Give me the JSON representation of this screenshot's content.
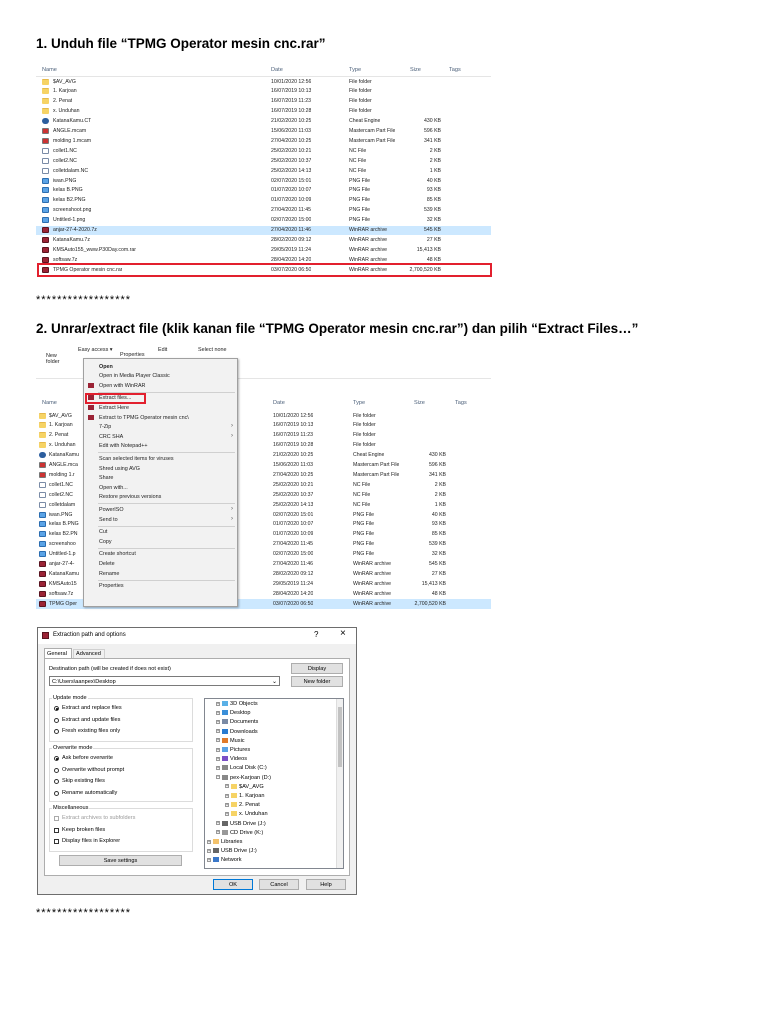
{
  "step1": {
    "title": "1.  Unduh file “TPMG Operator mesin cnc.rar”",
    "explorer": {
      "headers": {
        "name": "Name",
        "date": "Date",
        "type": "Type",
        "size": "Size",
        "tags": "Tags"
      },
      "rows": [
        {
          "name": "$AV_AVG",
          "date": "10/01/2020 12:56",
          "type": "File folder",
          "size": "",
          "icon": "folder"
        },
        {
          "name": "1. Karjoan",
          "date": "16/07/2019 10:13",
          "type": "File folder",
          "size": "",
          "icon": "folder"
        },
        {
          "name": "2. Penat",
          "date": "16/07/2019 11:23",
          "type": "File folder",
          "size": "",
          "icon": "folder"
        },
        {
          "name": "x. Unduhan",
          "date": "16/07/2019 10:28",
          "type": "File folder",
          "size": "",
          "icon": "folder"
        },
        {
          "name": "KatanaKamu.CT",
          "date": "21/02/2020 10:25",
          "type": "Cheat Engine",
          "size": "430 KB",
          "icon": "ce"
        },
        {
          "name": "ANGLE.mcam",
          "date": "15/06/2020 11:03",
          "type": "Mastercam Part File",
          "size": "596 KB",
          "icon": "mc"
        },
        {
          "name": "molding 1.mcam",
          "date": "27/04/2020 10:25",
          "type": "Mastercam Part File",
          "size": "341 KB",
          "icon": "mc"
        },
        {
          "name": "collet1.NC",
          "date": "25/02/2020 10:21",
          "type": "NC File",
          "size": "2 KB",
          "icon": "file"
        },
        {
          "name": "collet2.NC",
          "date": "25/02/2020 10:37",
          "type": "NC File",
          "size": "2 KB",
          "icon": "file"
        },
        {
          "name": "colletdalam.NC",
          "date": "25/02/2020 14:13",
          "type": "NC File",
          "size": "1 KB",
          "icon": "file"
        },
        {
          "name": "iwan.PNG",
          "date": "02/07/2020 15:01",
          "type": "PNG File",
          "size": "40 KB",
          "icon": "img"
        },
        {
          "name": "kelas B.PNG",
          "date": "01/07/2020 10:07",
          "type": "PNG File",
          "size": "93 KB",
          "icon": "img"
        },
        {
          "name": "kelas B2.PNG",
          "date": "01/07/2020 10:09",
          "type": "PNG File",
          "size": "85 KB",
          "icon": "img"
        },
        {
          "name": "screenshoot.png",
          "date": "27/04/2020 11:45",
          "type": "PNG File",
          "size": "539 KB",
          "icon": "img"
        },
        {
          "name": "Untitled-1.png",
          "date": "02/07/2020 15:00",
          "type": "PNG File",
          "size": "32 KB",
          "icon": "img"
        },
        {
          "name": "anjar-27-4-2020.7z",
          "date": "27/04/2020 11:46",
          "type": "WinRAR archive",
          "size": "545 KB",
          "icon": "rar",
          "selected": true
        },
        {
          "name": "KatanaKamu.7z",
          "date": "28/02/2020 09:12",
          "type": "WinRAR archive",
          "size": "27 KB",
          "icon": "rar"
        },
        {
          "name": "KMSAuto155_www.P30Day.com.rar",
          "date": "29/05/2019 11:24",
          "type": "WinRAR archive",
          "size": "15,413 KB",
          "icon": "rar"
        },
        {
          "name": "softsaw.7z",
          "date": "28/04/2020 14:20",
          "type": "WinRAR archive",
          "size": "48 KB",
          "icon": "rar"
        },
        {
          "name": "TPMG Operator mesin cnc.rar",
          "date": "03/07/2020 06:50",
          "type": "WinRAR archive",
          "size": "2,700,520 KB",
          "icon": "rar",
          "highlight": true
        }
      ]
    }
  },
  "separator": "******************",
  "step2": {
    "title": "2. Unrar/extract file (klik kanan file “TPMG Operator mesin cnc.rar”) dan pilih “Extract Files…”",
    "ribbon": {
      "new_folder": "New\nfolder",
      "easy_access": "Easy access ▾",
      "properties": "Properties",
      "edit": "Edit",
      "select_none": "Select none"
    },
    "context_menu": [
      {
        "label": "Open",
        "bold": true
      },
      {
        "label": "Open in Media Player Classic"
      },
      {
        "label": "Open with WinRAR",
        "icon": "rar"
      },
      {
        "label": "Extract files...",
        "icon": "rar",
        "highlight": true
      },
      {
        "label": "Extract Here",
        "icon": "rar"
      },
      {
        "label": "Extract to TPMG Operator mesin cnc\\",
        "icon": "rar"
      },
      {
        "label": "7-Zip",
        "submenu": true
      },
      {
        "label": "CRC SHA",
        "submenu": true
      },
      {
        "label": "Edit with Notepad++"
      },
      {
        "label": "Scan selected items for viruses"
      },
      {
        "label": "Shred using AVG"
      },
      {
        "label": "Share"
      },
      {
        "label": "Open with..."
      },
      {
        "label": "Restore previous versions"
      },
      {
        "label": "PowerISO",
        "submenu": true
      },
      {
        "label": "Send to",
        "submenu": true
      },
      {
        "label": "Cut"
      },
      {
        "label": "Copy"
      },
      {
        "label": "Create shortcut"
      },
      {
        "label": "Delete"
      },
      {
        "label": "Rename"
      },
      {
        "label": "Properties"
      }
    ],
    "behind_names": [
      "$AV_AVG",
      "1. Karjoan",
      "2. Penat",
      "x. Unduhan",
      "KatanaKamu",
      "ANGLE.mca",
      "molding 1.r",
      "collet1.NC",
      "collet2.NC",
      "colletdalam",
      "iwan.PNG",
      "kelas B.PNG",
      "kelas B2.PN",
      "screenshoo",
      "Untitled-1.p",
      "anjar-27-4-",
      "KatanaKamu",
      "KMSAuto15",
      "softsaw.7z",
      "TPMG Oper"
    ]
  },
  "dialog": {
    "title": "Extraction path and options",
    "help": "?",
    "close": "×",
    "tabs": [
      "General",
      "Advanced"
    ],
    "dest_label": "Destination path (will be created if does not exist)",
    "dest_value": "C:\\Users\\aanpex\\Desktop",
    "display_btn": "Display",
    "new_folder_btn": "New folder",
    "update_mode": {
      "title": "Update mode",
      "options": [
        "Extract and replace files",
        "Extract and update files",
        "Fresh existing files only"
      ],
      "selected": 0
    },
    "overwrite_mode": {
      "title": "Overwrite mode",
      "options": [
        "Ask before overwrite",
        "Overwrite without prompt",
        "Skip existing files",
        "Rename automatically"
      ],
      "selected": 0
    },
    "misc": {
      "title": "Miscellaneous",
      "options": [
        "Extract archives to subfolders",
        "Keep broken files",
        "Display files in Explorer"
      ]
    },
    "save_settings": "Save settings",
    "tree": [
      {
        "label": "3D Objects",
        "indent": 0,
        "icon": "3d"
      },
      {
        "label": "Desktop",
        "indent": 0,
        "icon": "desk"
      },
      {
        "label": "Documents",
        "indent": 0,
        "icon": "doc"
      },
      {
        "label": "Downloads",
        "indent": 0,
        "icon": "down"
      },
      {
        "label": "Music",
        "indent": 0,
        "icon": "music"
      },
      {
        "label": "Pictures",
        "indent": 0,
        "icon": "pic"
      },
      {
        "label": "Videos",
        "indent": 0,
        "icon": "vid"
      },
      {
        "label": "Local Disk (C:)",
        "indent": 0,
        "icon": "disk"
      },
      {
        "label": "pex-Karjoan (D:)",
        "indent": 0,
        "icon": "disk"
      },
      {
        "label": "$AV_AVG",
        "indent": 1,
        "icon": "folder"
      },
      {
        "label": "1. Karjoan",
        "indent": 1,
        "icon": "folder"
      },
      {
        "label": "2. Penat",
        "indent": 1,
        "icon": "folder"
      },
      {
        "label": "x. Unduhan",
        "indent": 1,
        "icon": "folder"
      },
      {
        "label": "USB Drive (J:)",
        "indent": 0,
        "icon": "usb"
      },
      {
        "label": "CD Drive (K:)",
        "indent": 0,
        "icon": "cd"
      },
      {
        "label": "Libraries",
        "indent": -1,
        "icon": "lib"
      },
      {
        "label": "USB Drive (J:)",
        "indent": -1,
        "icon": "usb"
      },
      {
        "label": "Network",
        "indent": -1,
        "icon": "net"
      }
    ],
    "ok": "OK",
    "cancel": "Cancel",
    "help_btn": "Help"
  },
  "colors": {
    "highlight_red": "#e2202e",
    "selection_blue": "#cce8ff",
    "header_text": "#4c607a"
  }
}
